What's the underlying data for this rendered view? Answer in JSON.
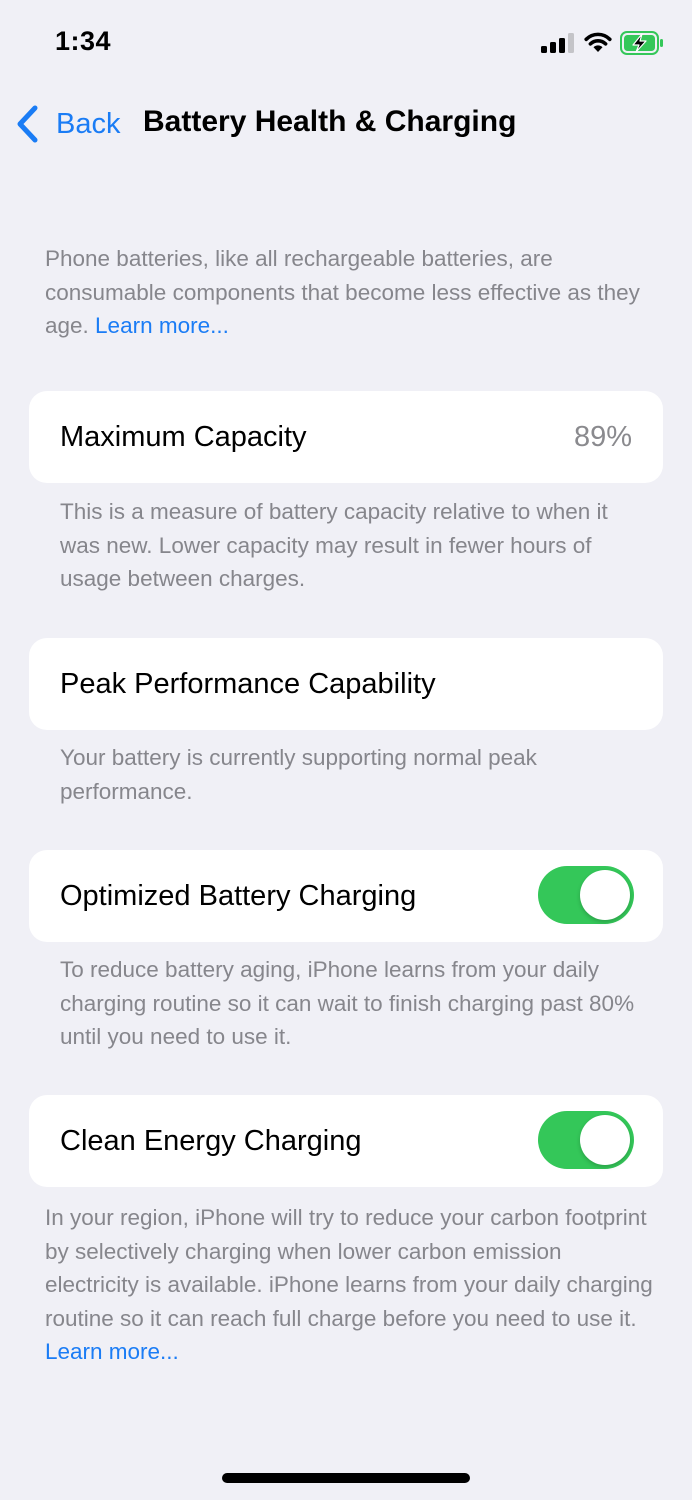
{
  "status_bar": {
    "time": "1:34",
    "icons": [
      "cellular-signal-icon",
      "wifi-icon",
      "battery-charging-icon"
    ]
  },
  "nav": {
    "back_label": "Back",
    "title": "Battery Health & Charging"
  },
  "intro": {
    "text": "Phone batteries, like all rechargeable batteries, are consumable components that become less effective as they age. ",
    "link": "Learn more..."
  },
  "maximum_capacity": {
    "label": "Maximum Capacity",
    "value": "89%",
    "footnote": "This is a measure of battery capacity relative to when it was new. Lower capacity may result in fewer hours of usage between charges."
  },
  "peak_performance": {
    "label": "Peak Performance Capability",
    "footnote": "Your battery is currently supporting normal peak performance."
  },
  "optimized_charging": {
    "label": "Optimized Battery Charging",
    "enabled": true,
    "footnote": "To reduce battery aging, iPhone learns from your daily charging routine so it can wait to finish charging past 80% until you need to use it."
  },
  "clean_energy": {
    "label": "Clean Energy Charging",
    "enabled": true,
    "footnote": "In your region, iPhone will try to reduce your carbon footprint by selectively charging when lower carbon emission electricity is available. iPhone learns from your daily charging routine so it can reach full charge before you need to use it. ",
    "link": "Learn more..."
  },
  "colors": {
    "accent": "#1a7cf5",
    "toggle_on": "#34c759",
    "background": "#f0f0f6",
    "secondary_text": "#86868c",
    "battery_fill": "#34c759"
  }
}
